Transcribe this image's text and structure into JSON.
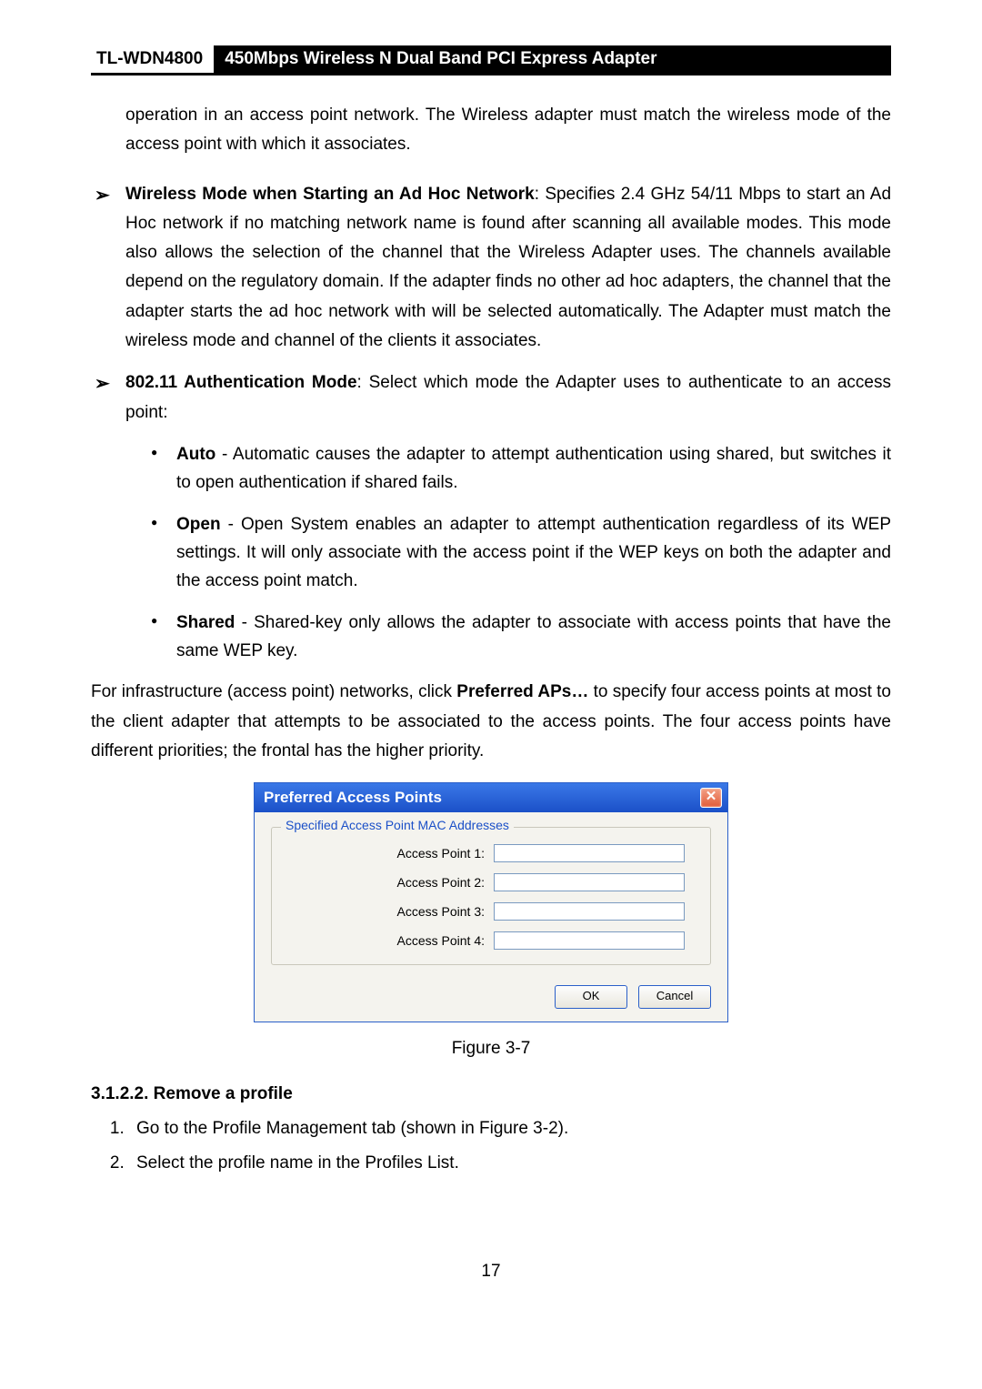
{
  "header": {
    "model": "TL-WDN4800",
    "title": "450Mbps Wireless N Dual Band PCI Express Adapter"
  },
  "intro_text": "operation in an access point network. The Wireless adapter must match the wireless mode of the access point with which it associates.",
  "bullets": {
    "b1_label": "Wireless Mode when Starting an Ad Hoc Network",
    "b1_text": ": Specifies 2.4 GHz 54/11 Mbps to start an Ad Hoc network if no matching network name is found after scanning all available modes. This mode also allows the selection of the channel that the Wireless Adapter uses. The channels available depend on the regulatory domain. If the adapter finds no other ad hoc adapters, the channel that the adapter starts the ad hoc network with will be selected automatically. The Adapter must match the wireless mode and channel of the clients it associates.",
    "b2_label": "802.11 Authentication Mode",
    "b2_text": ": Select which mode the Adapter uses to authenticate to an access point:",
    "auto_label": "Auto",
    "auto_text": " - Automatic causes the adapter to attempt authentication using shared, but switches it to open authentication if shared fails.",
    "open_label": "Open",
    "open_text": " - Open System enables an adapter to attempt authentication regardless of its WEP settings. It will only associate with the access point if the WEP keys on both the adapter and the access point match.",
    "shared_label": "Shared",
    "shared_text": " - Shared-key only allows the adapter to associate with access points that have the same WEP key."
  },
  "infra_pre": "For infrastructure (access point) networks, click ",
  "infra_bold": "Preferred APs…",
  "infra_post": " to specify four access points at most to the client adapter that attempts to be associated to the access points. The four access points have different priorities; the frontal has the higher priority.",
  "dialog": {
    "title": "Preferred Access Points",
    "close": "✕",
    "group_label": "Specified Access Point MAC Addresses",
    "ap1": "Access Point 1:",
    "ap2": "Access Point 2:",
    "ap3": "Access Point 3:",
    "ap4": "Access Point 4:",
    "ok": "OK",
    "cancel": "Cancel"
  },
  "figure_caption": "Figure 3-7",
  "section_heading": "3.1.2.2.  Remove a profile",
  "steps": {
    "s1": "Go to the Profile Management tab (shown in Figure 3-2).",
    "s2": "Select the profile name in the Profiles List."
  },
  "page_number": "17"
}
